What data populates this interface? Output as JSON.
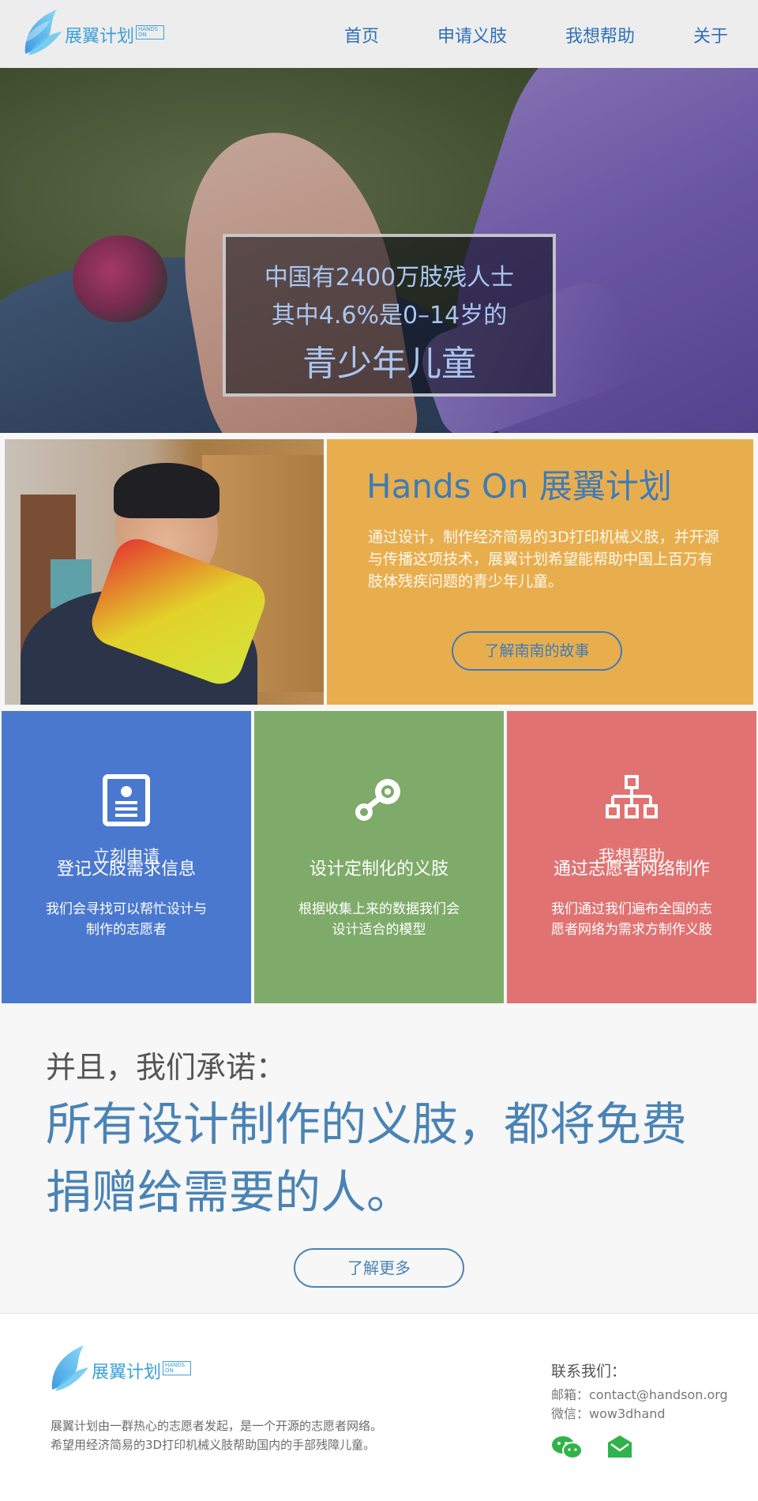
{
  "nav": {
    "logo_text": "展翼计划",
    "logo_badge": "HANDS ON",
    "items": [
      {
        "label": "首页"
      },
      {
        "label": "申请义肢"
      },
      {
        "label": "我想帮助"
      },
      {
        "label": "关于"
      }
    ]
  },
  "hero": {
    "line1": "中国有2400万肢残人士",
    "line2": "其中4.6%是0–14岁的",
    "line3": "青少年儿童"
  },
  "intro": {
    "title": "Hands On 展翼计划",
    "description": "通过设计，制作经济简易的3D打印机械义肢，并开源与传播这项技术，展翼计划希望能帮助中国上百万有肢体残疾问题的青少年儿童。",
    "button": "了解南南的故事"
  },
  "features": [
    {
      "overlay": "立刻申请",
      "title": "登记义肢需求信息",
      "body": "我们会寻找可以帮忙设计与制作的志愿者",
      "icon": "id-card-icon",
      "color": "#4a78cf"
    },
    {
      "overlay": "",
      "title": "设计定制化的义肢",
      "body": "根据收集上来的数据我们会设计适合的模型",
      "icon": "steam-wrench-icon",
      "color": "#7eab6a"
    },
    {
      "overlay": "我想帮助",
      "title": "通过志愿者网络制作",
      "body": "我们通过我们遍布全国的志愿者网络为需求方制作义肢",
      "icon": "network-icon",
      "color": "#e07372"
    }
  ],
  "promise": {
    "lead": "并且，我们承诺：",
    "main": "所有设计制作的义肢，都将免费捐赠给需要的人。",
    "button": "了解更多"
  },
  "footer": {
    "logo_text": "展翼计划",
    "logo_badge": "HANDS ON",
    "about_line1": "展翼计划由一群热心的志愿者发起，是一个开源的志愿者网络。",
    "about_line2": "希望用经济简易的3D打印机械义肢帮助国内的手部残障儿童。",
    "contact_title": "联系我们：",
    "email": "邮箱：contact@handson.org",
    "wechat": "微信：wow3dhand",
    "icons": [
      "wechat-icon",
      "email-icon"
    ]
  }
}
